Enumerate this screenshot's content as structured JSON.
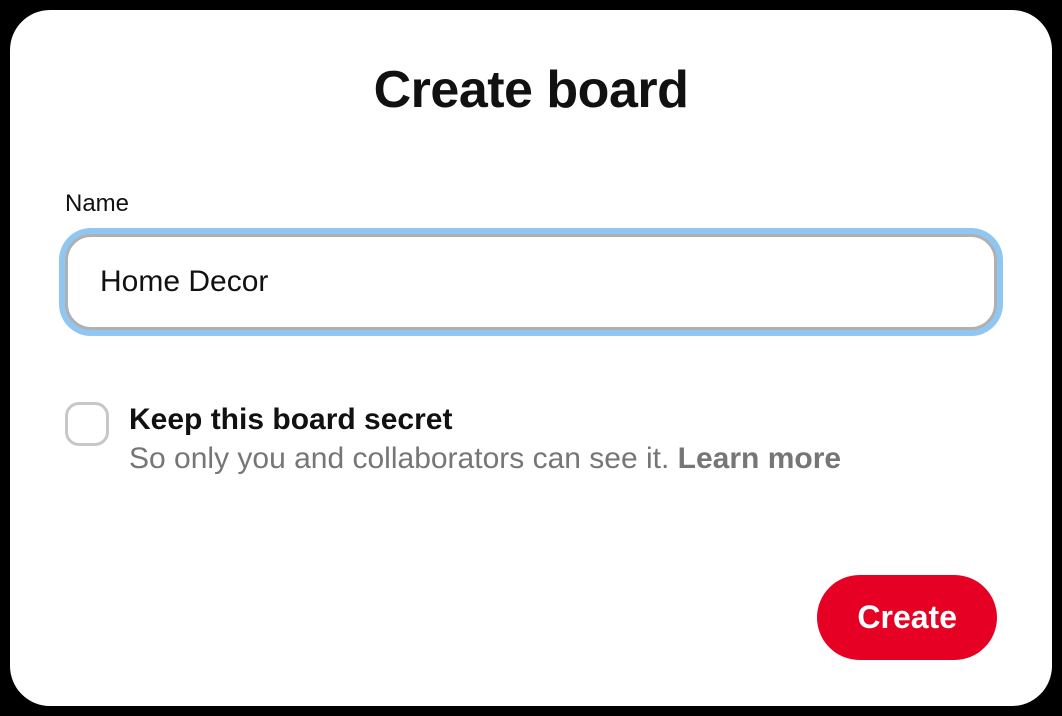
{
  "modal": {
    "title": "Create board",
    "name_field": {
      "label": "Name",
      "value": "Home Decor"
    },
    "secret": {
      "title": "Keep this board secret",
      "description": "So only you and collaborators can see it. ",
      "learn_more": "Learn more",
      "checked": false
    },
    "create_button": "Create"
  }
}
